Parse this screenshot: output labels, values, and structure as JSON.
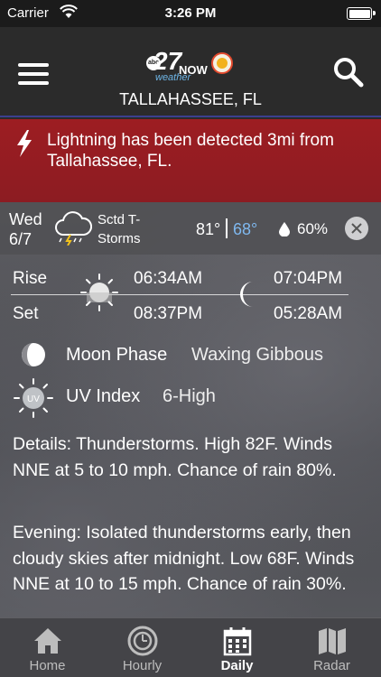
{
  "status_bar": {
    "carrier": "Carrier",
    "time": "3:26 PM"
  },
  "header": {
    "logo": {
      "abc": "abc",
      "number": "27",
      "word_now": "NOW",
      "word_weather": "weather"
    },
    "location": "TALLAHASSEE, FL"
  },
  "alert": {
    "message": "Lightning has been detected 3mi from Tallahassee, FL."
  },
  "forecast": {
    "day": "Wed",
    "date": "6/7",
    "condition_line1": "Sctd T-",
    "condition_line2": "Storms",
    "high": "81°",
    "low": "68°",
    "precip": "60%",
    "condition_icon": "thunderstorm-cloud-icon"
  },
  "sun_moon": {
    "rise_label": "Rise",
    "set_label": "Set",
    "sunrise": "06:34AM",
    "sunset": "08:37PM",
    "moonrise": "07:04PM",
    "moonset": "05:28AM"
  },
  "moon_phase": {
    "label": "Moon Phase",
    "value": "Waxing Gibbous"
  },
  "uv": {
    "icon_text": "UV",
    "label": "UV Index",
    "value": "6-High"
  },
  "details": "Details: Thunderstorms. High 82F. Winds NNE at 5 to 10 mph. Chance of rain 80%.",
  "evening": "Evening: Isolated thunderstorms early, then cloudy skies after midnight. Low 68F. Winds NNE at 10 to 15 mph. Chance of rain 30%.",
  "tabs": [
    {
      "label": "Home",
      "icon": "home-icon",
      "active": false
    },
    {
      "label": "Hourly",
      "icon": "clock-icon",
      "active": false
    },
    {
      "label": "Daily",
      "icon": "calendar-icon",
      "active": true
    },
    {
      "label": "Radar",
      "icon": "map-icon",
      "active": false
    }
  ],
  "colors": {
    "alert_bg": "#9d1d22",
    "low_temp": "#7fb8ef",
    "header_bg": "#2b2b2b",
    "header_border": "#3b3f8f"
  }
}
